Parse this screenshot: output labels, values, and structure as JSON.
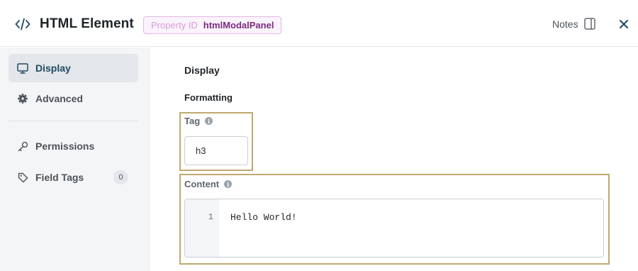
{
  "header": {
    "title": "HTML Element",
    "property_id_label": "Property ID",
    "property_id_value": "htmlModalPanel",
    "notes_label": "Notes",
    "icons": {
      "title": "code-icon",
      "notes": "panel-icon",
      "close": "close-icon"
    }
  },
  "sidebar": {
    "items": [
      {
        "label": "Display",
        "icon": "monitor-icon",
        "active": true
      },
      {
        "label": "Advanced",
        "icon": "gear-icon",
        "active": false
      },
      {
        "label": "Permissions",
        "icon": "key-icon",
        "active": false
      },
      {
        "label": "Field Tags",
        "icon": "tag-icon",
        "active": false,
        "count": "0"
      }
    ]
  },
  "main": {
    "section_title": "Display",
    "subsection_title": "Formatting",
    "tag_field": {
      "label": "Tag",
      "value": "h3"
    },
    "content_field": {
      "label": "Content",
      "lines": [
        {
          "number": "1",
          "code": "Hello World!"
        }
      ]
    }
  },
  "colors": {
    "accent": "#1f4a64",
    "highlight_border": "#bfa96e",
    "badge_border": "#e3b6e6",
    "badge_text": "#7a2a80"
  }
}
